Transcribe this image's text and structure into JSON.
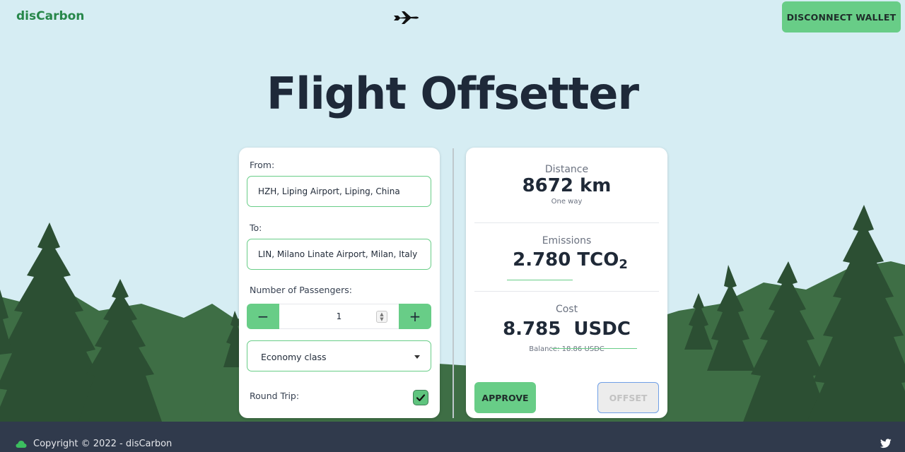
{
  "header": {
    "brand": "disCarbon",
    "disconnect_label": "DISCONNECT WALLET"
  },
  "title": "Flight Offsetter",
  "form": {
    "from_label": "From:",
    "from_value": "HZH, Liping Airport, Liping, China",
    "to_label": "To:",
    "to_value": "LIN, Milano Linate Airport, Milan, Italy",
    "passengers_label": "Number of Passengers:",
    "passengers_value": "1",
    "minus_label": "−",
    "plus_label": "+",
    "class_value": "Economy class",
    "round_trip_label": "Round Trip:",
    "round_trip_checked": true
  },
  "summary": {
    "distance_title": "Distance",
    "distance_value": "8672 km",
    "distance_note": "One way",
    "emissions_title": "Emissions",
    "emissions_value": "2.780",
    "emissions_unit": "TCO",
    "emissions_sub": "2",
    "cost_title": "Cost",
    "cost_value": "8.785",
    "cost_unit": "USDC",
    "balance": "Balance: 18.86 USDC",
    "approve_label": "APPROVE",
    "offset_label": "OFFSET"
  },
  "footer": {
    "copyright": "Copyright © 2022 - disCarbon"
  },
  "colors": {
    "accent": "#68cd87",
    "brand": "#27874a",
    "sky": "#d6edf3",
    "footer": "#303a4c",
    "tree_dark": "#2c4f33",
    "tree_mid": "#3e6e45"
  },
  "icons": [
    "airplane-icon",
    "cloud-icon",
    "twitter-icon",
    "checkmark-icon",
    "chevron-down-icon"
  ]
}
